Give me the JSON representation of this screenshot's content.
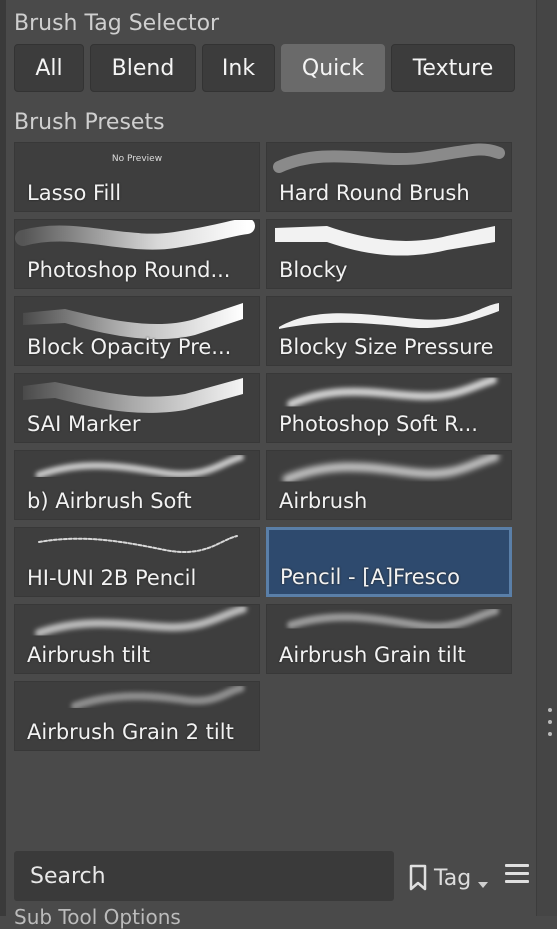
{
  "tag_selector": {
    "title": "Brush Tag Selector",
    "tabs": [
      "All",
      "Blend",
      "Ink",
      "Quick",
      "Texture"
    ],
    "active_tab": "Quick"
  },
  "presets": {
    "title": "Brush Presets",
    "no_preview": "No Preview",
    "items": [
      {
        "label": "Lasso Fill",
        "preview": "none"
      },
      {
        "label": "Hard Round Brush",
        "preview": "hard-round"
      },
      {
        "label": "Photoshop Round...",
        "preview": "ps-round"
      },
      {
        "label": "Blocky",
        "preview": "blocky"
      },
      {
        "label": "Block Opacity Pre...",
        "preview": "block-opacity"
      },
      {
        "label": "Blocky Size Pressure",
        "preview": "blocky-size"
      },
      {
        "label": "SAI Marker",
        "preview": "sai-marker"
      },
      {
        "label": "Photoshop Soft R...",
        "preview": "ps-soft"
      },
      {
        "label": "b) Airbrush Soft",
        "preview": "airbrush-soft"
      },
      {
        "label": "Airbrush",
        "preview": "airbrush"
      },
      {
        "label": "HI-UNI 2B Pencil",
        "preview": "pencil"
      },
      {
        "label": "Pencil - [A]Fresco",
        "preview": "none",
        "selected": true
      },
      {
        "label": "Airbrush tilt",
        "preview": "airbrush-tilt"
      },
      {
        "label": "Airbrush Grain tilt",
        "preview": "grain-tilt"
      },
      {
        "label": "Airbrush Grain 2 tilt",
        "preview": "grain2-tilt"
      }
    ]
  },
  "search": {
    "placeholder": "Search"
  },
  "tag_button": {
    "label": "Tag",
    "icon": "bookmark-icon"
  },
  "menu_icon": "hamburger-menu-icon",
  "bottom_section_title": "Sub Tool Options"
}
